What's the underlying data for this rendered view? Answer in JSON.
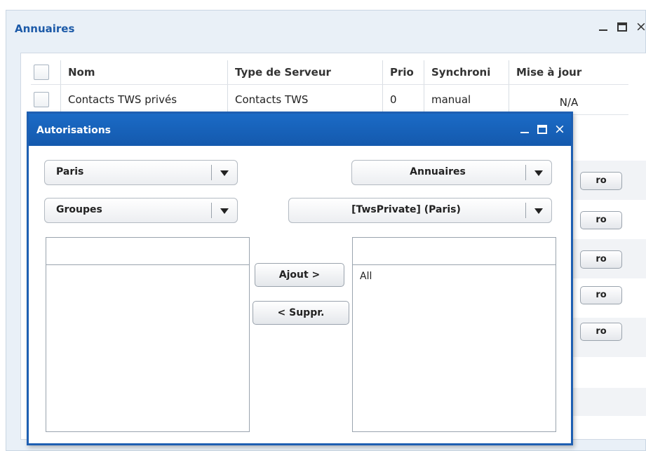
{
  "annuaires_window": {
    "title": "Annuaires",
    "columns": [
      "Nom",
      "Type de Serveur",
      "Prio",
      "Synchroni",
      "Mise à jour"
    ],
    "rows": [
      {
        "nom": "Contacts TWS privés",
        "type": "Contacts TWS",
        "prio": "0",
        "sync": "manual",
        "maj": "N/A"
      }
    ],
    "row_button_label": "ro"
  },
  "autorisations_window": {
    "title": "Autorisations",
    "left_site_select": "Paris",
    "left_type_select": "Groupes",
    "right_object_select": "Annuaires",
    "right_item_select": "[TwsPrivate] (Paris)",
    "add_button": "Ajout >",
    "remove_button": "< Suppr.",
    "right_list_items": [
      "All"
    ]
  }
}
